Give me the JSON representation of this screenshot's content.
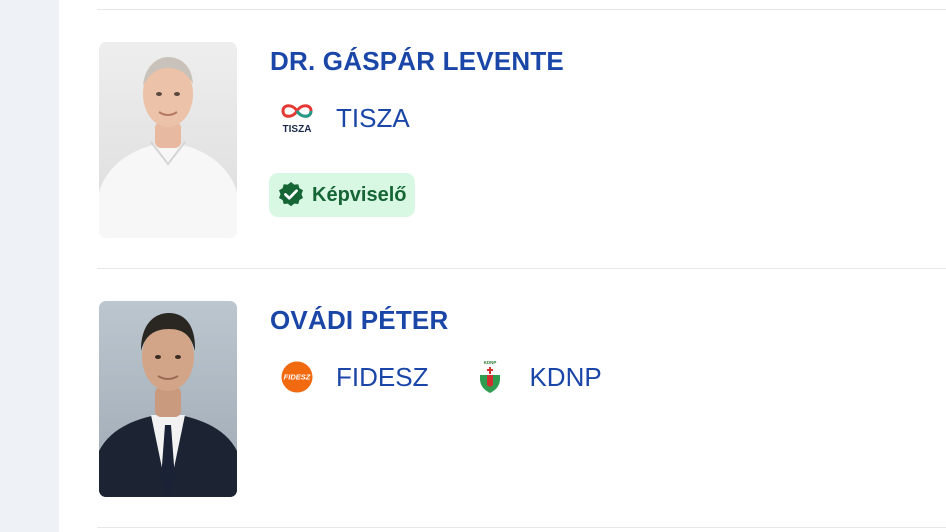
{
  "candidates": [
    {
      "name": "DR. GÁSPÁR LEVENTE",
      "parties": [
        {
          "label": "TISZA",
          "logo_text": "TISZA",
          "logo_icon": "tisza-infinity-logo"
        }
      ],
      "badge": {
        "label": "Képviselő",
        "icon": "verified-check-icon",
        "color": "#166534",
        "background": "#d9f8e4"
      }
    },
    {
      "name": "OVÁDI PÉTER",
      "parties": [
        {
          "label": "FIDESZ",
          "logo_text": "FIDESZ",
          "logo_icon": "fidesz-orange-circle-logo"
        },
        {
          "label": "KDNP",
          "logo_text": "KDNP",
          "logo_icon": "kdnp-shield-logo"
        }
      ]
    }
  ],
  "colors": {
    "link_blue": "#1a46a8",
    "rail": "#eef1f6",
    "divider": "#e5e7eb",
    "fidesz_orange": "#f26a10",
    "tisza_red": "#e53935"
  }
}
